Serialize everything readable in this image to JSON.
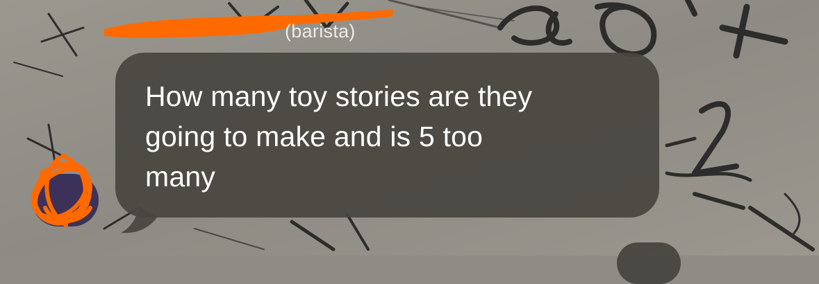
{
  "conversation": {
    "sender_name_visible": "(barista)",
    "message": {
      "line1": "How many toy stories are they",
      "line2": "going to make and is 5 too",
      "line3": "many"
    }
  },
  "colors": {
    "bubble": "#48463f",
    "redaction": "#ff6a00",
    "avatar": "#3c3158",
    "text": "#ffffff"
  },
  "icons": {
    "avatar": "contact-avatar-icon"
  }
}
